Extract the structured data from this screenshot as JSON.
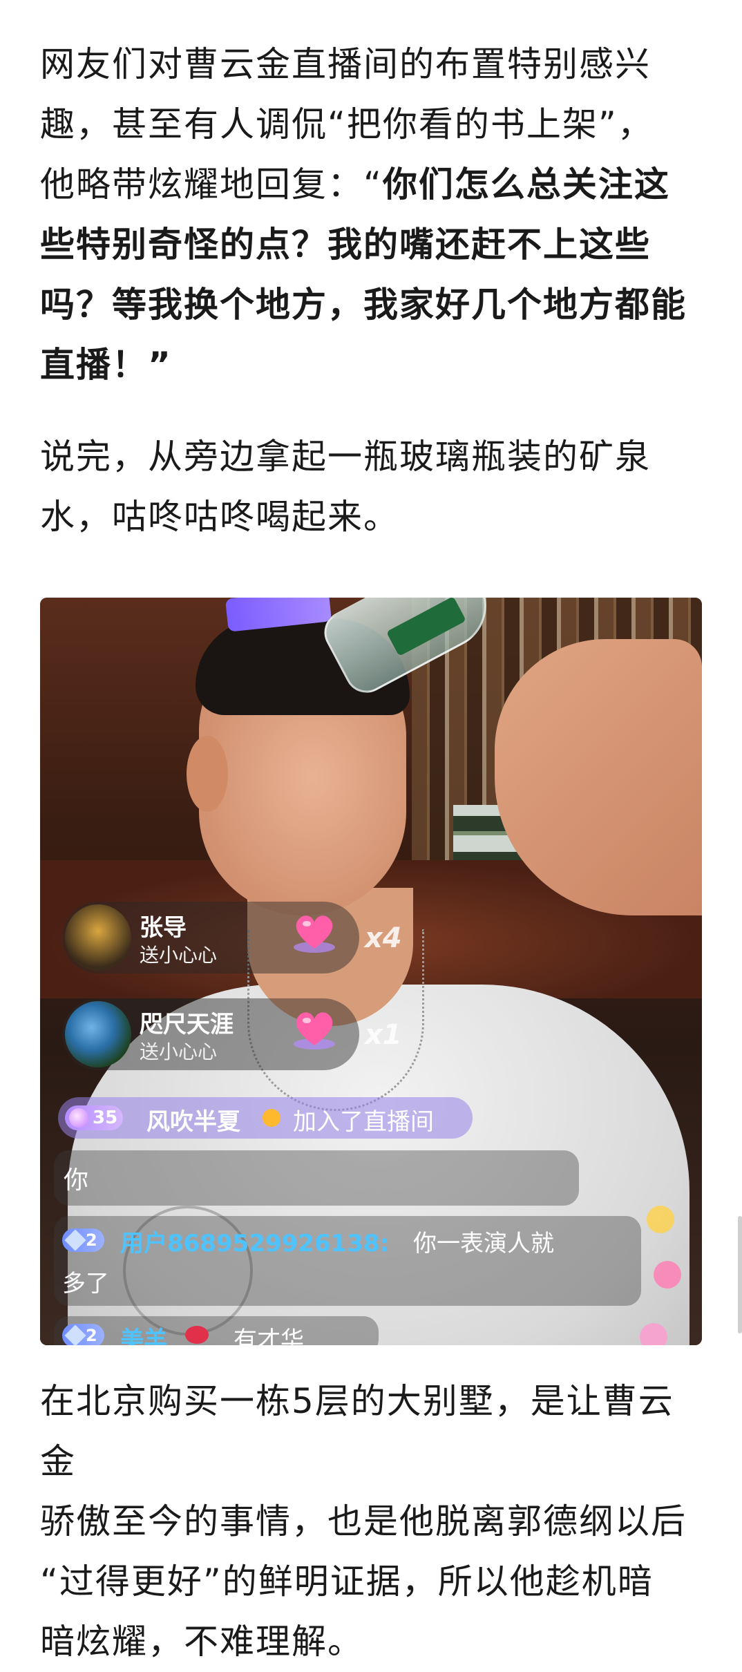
{
  "paragraph1": {
    "line1": "网友们对曹云金直播间的布置特别感兴",
    "line2": "趣，甚至有人调侃“把你看的书上架”，",
    "line3_normal": "他略带炫耀地回复：“",
    "line3_bold": "你们怎么总关注这",
    "line4": "些特别奇怪的点？我的嘴还赶不上这些",
    "line5": "吗？等我换个地方，我家好几个地方都能",
    "line6": "直播！”"
  },
  "paragraph2": {
    "line1": "说完，从旁边拿起一瓶玻璃瓶装的矿泉",
    "line2": "水，咕咚咕咚喝起来。"
  },
  "stream": {
    "gifts": [
      {
        "name": "张导",
        "action": "送小心心",
        "count": "x4"
      },
      {
        "name": "咫尺天涯",
        "action": "送小心心",
        "count": "x1"
      }
    ],
    "join": {
      "level": "35",
      "name": "风吹半夏",
      "text": "加入了直播间"
    },
    "comments": [
      {
        "text": "你"
      },
      {
        "level": "2",
        "user": "用户8689529926138:",
        "text": "你一表演人就",
        "text2": "多了"
      },
      {
        "level": "2",
        "user": "美羊",
        "text": "有才华"
      }
    ]
  },
  "paragraph3": {
    "line1": "在北京购买一栋5层的大别墅，是让曹云金",
    "line2": "骄傲至今的事情，也是他脱离郭德纲以后",
    "line3": "“过得更好”的鲜明证据，所以他趁机暗",
    "line4": "暗炫耀，不难理解。"
  },
  "colors": {
    "text": "#1a1a1a",
    "username": "#4fc3ff",
    "join_bg": "#9682e6",
    "heart": "#ff5fa8"
  }
}
